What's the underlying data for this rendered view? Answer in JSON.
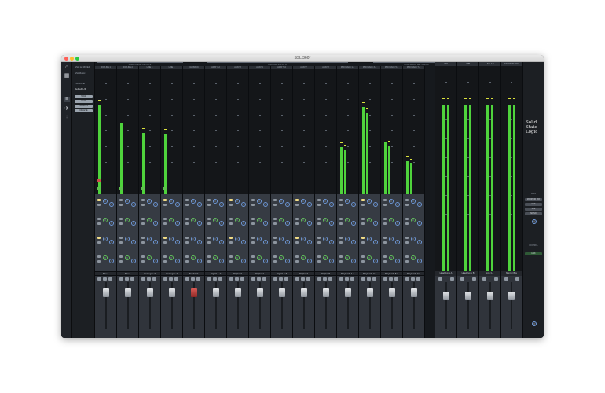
{
  "window": {
    "title": "SSL 360°"
  },
  "colors": {
    "meter": "#4fd33c",
    "peak": "#dbe23d",
    "panel": "#16191d",
    "accent_blue": "#6f99d9"
  },
  "icons": [
    "home-icon",
    "grid-icon",
    "list-icon",
    "mixer-icon",
    "plane-icon",
    "settings-icon"
  ],
  "sidebar": {
    "device": "SSL 12 MIXER",
    "device_sub": "SSLMusic",
    "profile_label": "PROFILE",
    "profile_value": "Default L/R",
    "buttons": [
      "SAVE",
      "LOAD",
      "SAVE AS",
      "DELETE"
    ]
  },
  "groups": [
    "ANALOGUE INPUTS",
    "DIGITAL INPUTS",
    "PLAYBACK RETURNS"
  ],
  "channels": [
    {
      "name": "Mic 1",
      "top": "MIC/LINE 1",
      "level": 0.76,
      "peak": 0.78,
      "rec": true,
      "talkback": false
    },
    {
      "name": "Mic 2",
      "top": "MIC/LINE 2",
      "level": 0.6,
      "peak": 0.62,
      "rec": false,
      "talkback": false
    },
    {
      "name": "Analogue 3",
      "top": "LINE 3",
      "level": 0.52,
      "peak": 0.54,
      "rec": false,
      "talkback": false
    },
    {
      "name": "Analogue 4",
      "top": "LINE 4",
      "level": 0.51,
      "peak": 0.53,
      "rec": false,
      "talkback": false
    },
    {
      "name": "Talkback",
      "top": "TALKBACK",
      "level": 0.0,
      "peak": 0.0,
      "rec": false,
      "talkback": true
    },
    {
      "name": "Digital 1-2",
      "top": "ADAT 1-2",
      "level": 0.0,
      "peak": 0.0,
      "rec": false,
      "talkback": false
    },
    {
      "name": "Digital 3",
      "top": "ADAT 3",
      "level": 0.0,
      "peak": 0.0,
      "rec": false,
      "talkback": false
    },
    {
      "name": "Digital 4",
      "top": "ADAT 4",
      "level": 0.0,
      "peak": 0.0,
      "rec": false,
      "talkback": false
    },
    {
      "name": "Digital 5-6",
      "top": "ADAT 5-6",
      "level": 0.0,
      "peak": 0.0,
      "rec": false,
      "talkback": false
    },
    {
      "name": "Digital 7",
      "top": "ADAT 7",
      "level": 0.0,
      "peak": 0.0,
      "rec": false,
      "talkback": false
    },
    {
      "name": "Digital 8",
      "top": "ADAT 8",
      "level": 0.0,
      "peak": 0.0,
      "rec": false,
      "talkback": false
    },
    {
      "name": "Playback 1-2",
      "top": "PLAYBACK 1-2",
      "level": 0.4,
      "peak": 0.42,
      "rec": false,
      "talkback": false
    },
    {
      "name": "Playback 3-4",
      "top": "PLAYBACK 3-4",
      "level": 0.74,
      "peak": 0.76,
      "rec": false,
      "talkback": false
    },
    {
      "name": "Playback 5-6",
      "top": "PLAYBACK 5-6",
      "level": 0.44,
      "peak": 0.46,
      "rec": false,
      "talkback": false
    },
    {
      "name": "Playback 7-8",
      "top": "PLAYBACK 7-8",
      "level": 0.28,
      "peak": 0.3,
      "rec": false,
      "talkback": false
    }
  ],
  "outputs": [
    {
      "name": "Headphone A",
      "top": "HPA",
      "level": 0.83,
      "peak": 0.85
    },
    {
      "name": "Headphone B",
      "top": "HPB",
      "level": 0.83,
      "peak": 0.85
    },
    {
      "name": "Line 3-4",
      "top": "LINE 3-4",
      "level": 0.83,
      "peak": 0.85
    }
  ],
  "master": {
    "name": "Monitor Bus",
    "top": "MONITOR MIX",
    "level": 0.83,
    "peak": 0.85
  },
  "right_panel": {
    "logo": [
      "Solid",
      "State",
      "Logic"
    ],
    "section": "MAIN",
    "buttons": [
      "MONITOR MIX",
      "CUT",
      "DIM",
      "MONO"
    ],
    "footer": [
      "CONTROL",
      "LINK"
    ]
  }
}
